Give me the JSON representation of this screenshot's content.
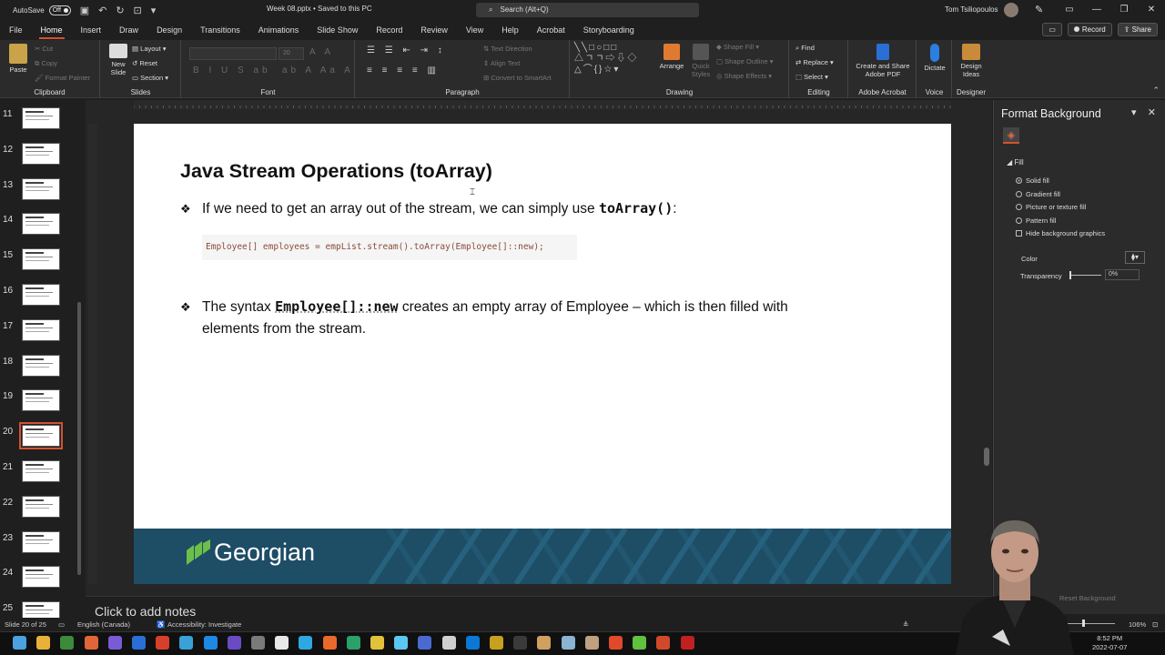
{
  "titlebar": {
    "autosave_label": "AutoSave",
    "autosave_state": "Off",
    "doc_title": "Week 08.pptx • Saved to this PC",
    "search_placeholder": "Search (Alt+Q)",
    "user_name": "Tom Tsiliopoulos"
  },
  "tabs": [
    "File",
    "Home",
    "Insert",
    "Draw",
    "Design",
    "Transitions",
    "Animations",
    "Slide Show",
    "Record",
    "Review",
    "View",
    "Help",
    "Acrobat",
    "Storyboarding"
  ],
  "active_tab": "Home",
  "tab_right": {
    "record": "Record",
    "share": "Share"
  },
  "ribbon": {
    "clipboard": {
      "label": "Clipboard",
      "paste": "Paste",
      "cut": "Cut",
      "copy": "Copy",
      "format_painter": "Format Painter"
    },
    "slides": {
      "label": "Slides",
      "new_slide": "New Slide",
      "layout": "Layout",
      "reset": "Reset",
      "section": "Section"
    },
    "font": {
      "label": "Font",
      "size": "20"
    },
    "paragraph": {
      "label": "Paragraph",
      "text_direction": "Text Direction",
      "align_text": "Align Text",
      "convert_smartart": "Convert to SmartArt"
    },
    "drawing": {
      "label": "Drawing",
      "arrange": "Arrange",
      "quick_styles": "Quick Styles",
      "shape_fill": "Shape Fill",
      "shape_outline": "Shape Outline",
      "shape_effects": "Shape Effects"
    },
    "editing": {
      "label": "Editing",
      "find": "Find",
      "replace": "Replace",
      "select": "Select"
    },
    "adobe": {
      "label": "Adobe Acrobat",
      "button": "Create and Share Adobe PDF"
    },
    "voice": {
      "label": "Voice",
      "button": "Dictate"
    },
    "designer": {
      "label": "Designer",
      "button": "Design Ideas"
    }
  },
  "thumbnails": [
    {
      "num": "11"
    },
    {
      "num": "12"
    },
    {
      "num": "13"
    },
    {
      "num": "14"
    },
    {
      "num": "15"
    },
    {
      "num": "16"
    },
    {
      "num": "17"
    },
    {
      "num": "18"
    },
    {
      "num": "19"
    },
    {
      "num": "20"
    },
    {
      "num": "21"
    },
    {
      "num": "22"
    },
    {
      "num": "23"
    },
    {
      "num": "24"
    },
    {
      "num": "25"
    }
  ],
  "selected_slide": "20",
  "slide": {
    "title": "Java Stream Operations (toArray)",
    "bullet1_prefix": "If we need to get an array out of the stream, we can simply use ",
    "bullet1_code": "toArray()",
    "bullet1_suffix": ":",
    "code_line": "Employee[] employees = empList.stream().toArray(Employee[]::new);",
    "bullet2_prefix": "The syntax ",
    "bullet2_code": "Employee[]::new",
    "bullet2_suffix": "  creates an empty array of Employee – which is then filled with",
    "bullet2_line2": "elements from the stream.",
    "logo_text": "Georgian"
  },
  "format_pane": {
    "title": "Format Background",
    "fill_section": "Fill",
    "options": [
      "Solid fill",
      "Gradient fill",
      "Picture or texture fill",
      "Pattern fill"
    ],
    "selected_option": "Solid fill",
    "hide_graphics": "Hide background graphics",
    "color_label": "Color",
    "transparency_label": "Transparency",
    "transparency_value": "0%",
    "reset_button": "Reset Background"
  },
  "notes": {
    "placeholder": "Click to add notes"
  },
  "status": {
    "slide_counter": "Slide 20 of 25",
    "language": "English (Canada)",
    "accessibility": "Accessibility: Investigate",
    "zoom": "106%"
  },
  "clock": {
    "time": "8:52 PM",
    "date": "2022-07-07"
  },
  "colors": {
    "accent": "#d35230",
    "slide_footer": "#1e4d66",
    "logo_green": "#6cc04a",
    "code_text": "#8b4a3a"
  }
}
